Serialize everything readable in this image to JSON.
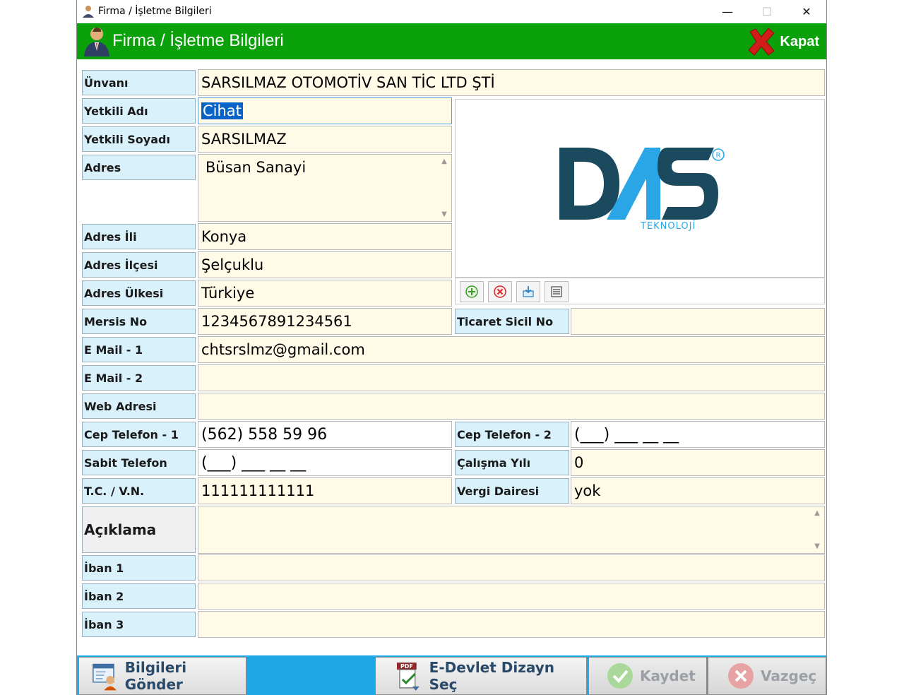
{
  "window": {
    "title": "Firma / İşletme Bilgileri",
    "minimize": "—",
    "maximize": "☐",
    "close": "✕"
  },
  "header": {
    "title": "Firma / İşletme Bilgileri",
    "close_label": "Kapat"
  },
  "labels": {
    "unvan": "Ünvanı",
    "yetkili_adi": "Yetkili Adı",
    "yetkili_soyadi": "Yetkili Soyadı",
    "adres": "Adres",
    "adres_ili": "Adres İli",
    "adres_ilcesi": "Adres İlçesi",
    "adres_ulkesi": "Adres Ülkesi",
    "mersis_no": "Mersis No",
    "ticaret_sicil_no": "Ticaret Sicil No",
    "email1": "E Mail - 1",
    "email2": "E Mail - 2",
    "web": "Web Adresi",
    "cep1": "Cep Telefon - 1",
    "cep2": "Cep Telefon - 2",
    "sabit": "Sabit Telefon",
    "calisma_yili": "Çalışma Yılı",
    "tc_vn": "T.C. / V.N.",
    "vergi_dairesi": "Vergi Dairesi",
    "aciklama": "Açıklama",
    "iban1": "İban 1",
    "iban2": "İban 2",
    "iban3": "İban 3"
  },
  "values": {
    "unvan": "SARSILMAZ  OTOMOTİV SAN TİC LTD ŞTİ",
    "yetkili_adi": "Cihat",
    "yetkili_soyadi": "SARSILMAZ",
    "adres": "Büsan Sanayi",
    "adres_ili": "Konya",
    "adres_ilcesi": "Şelçuklu",
    "adres_ulkesi": "Türkiye",
    "mersis_no": "1234567891234561",
    "ticaret_sicil_no": "",
    "email1": "chtsrslmz@gmail.com",
    "email2": "",
    "web": "",
    "cep1": "(562) 558 59 96",
    "cep2": "(___) ___ __ __",
    "sabit": "(___) ___ __ __",
    "calisma_yili": "0",
    "tc_vn": "111111111111",
    "vergi_dairesi": "yok",
    "aciklama": "",
    "iban1": "",
    "iban2": "",
    "iban3": ""
  },
  "logo": {
    "main": "DAS",
    "sub": "TEKNOLOJİ",
    "mark": "R"
  },
  "photo_toolbar": {
    "icons": [
      "add-icon",
      "delete-icon",
      "load-icon",
      "view-icon"
    ]
  },
  "buttons": {
    "send": "Bilgileri Gönder",
    "edevlet": "E-Devlet Dizayn Seç",
    "save": "Kaydet",
    "cancel": "Vazgeç"
  },
  "colors": {
    "header_green": "#0ba10b",
    "label_bg": "#d9f1fb",
    "field_bg": "#fffbe6",
    "bottom_bar": "#1ea8e8",
    "logo_dark": "#1b4a5e",
    "logo_light": "#2aa6e6"
  }
}
